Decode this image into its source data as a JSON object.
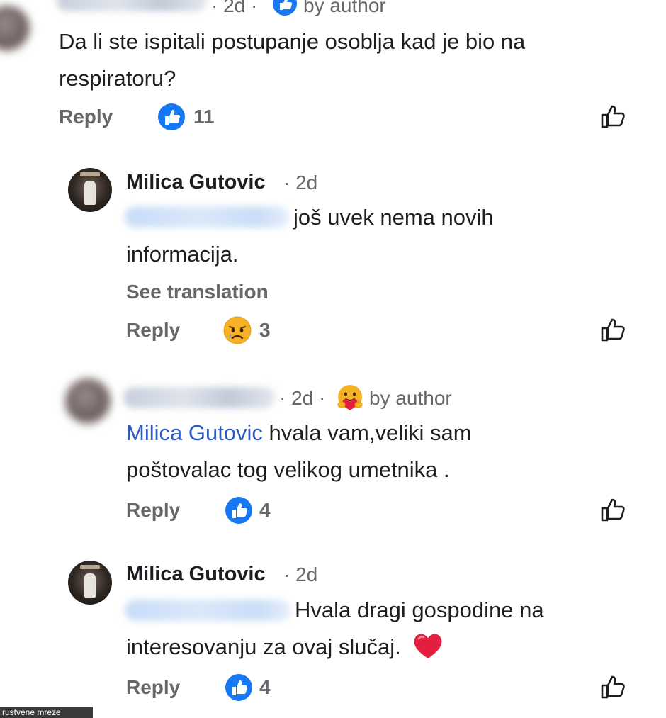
{
  "comments": [
    {
      "time": "· 2d ·",
      "author_badge": "by author",
      "text": "Da li ste ispitali postupanje osoblja kad je bio na respiratoru?",
      "reply_label": "Reply",
      "reaction_icon": "like-reaction-icon",
      "reaction_count": "11"
    },
    {
      "author": "Milica Gutovic",
      "time": "· 2d",
      "text_line1": "još uvek nema novih",
      "text_line2": "informacija.",
      "see_translation": "See translation",
      "reply_label": "Reply",
      "reaction_icon": "sad-reaction-icon",
      "reaction_count": "3"
    },
    {
      "time": "· 2d ·",
      "author_badge": "by author",
      "mention": "Milica Gutovic",
      "text_line1": " hvala vam,veliki sam",
      "text_line2": "poštovalac tog velikog umetnika .",
      "reply_label": "Reply",
      "reaction_icon": "like-reaction-icon",
      "reaction_count": "4"
    },
    {
      "author": "Milica Gutovic",
      "time": "· 2d",
      "text_line1": "Hvala dragi gospodine na",
      "text_line2": "interesovanju za ovaj slučaj.",
      "emoji": "❤️",
      "reply_label": "Reply",
      "reaction_icon": "like-reaction-icon",
      "reaction_count": "4"
    }
  ],
  "watermark": "rustvene mreze",
  "colors": {
    "facebook_blue": "#1877f2",
    "secondary_text": "#65676b",
    "mention_link": "#2d59c4",
    "heart": "#e41e3f"
  }
}
